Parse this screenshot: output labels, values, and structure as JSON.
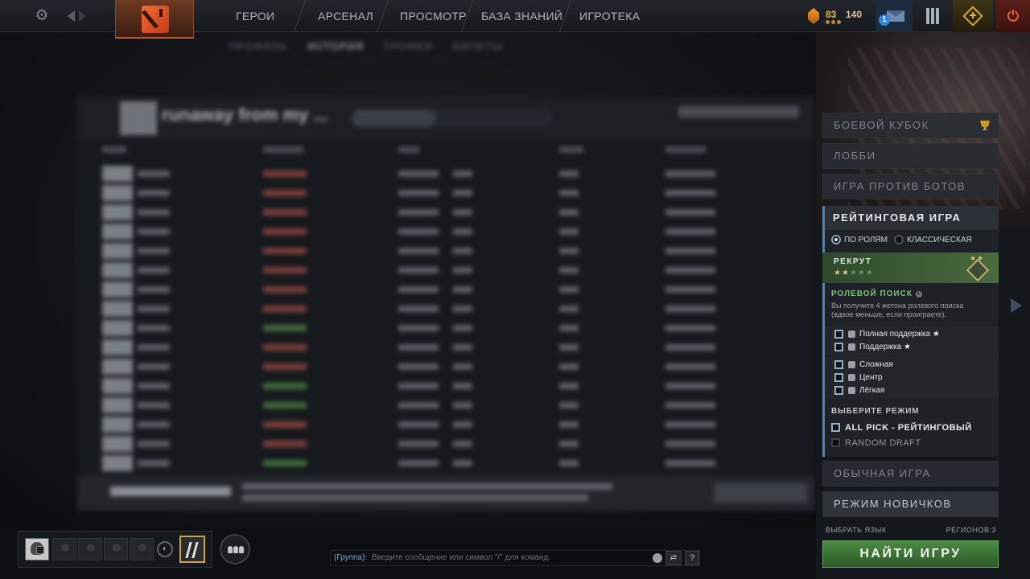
{
  "topbar": {
    "nav": [
      "ГЕРОИ",
      "АРСЕНАЛ",
      "ПРОСМОТР",
      "БАЗА ЗНАНИЙ",
      "ИГРОТЕКА"
    ],
    "gold": "83",
    "shards": "140",
    "mail_badge": "1",
    "icons": {
      "settings": "gear-icon",
      "back": "arrow-left-icon",
      "forward": "arrow-right-icon",
      "logo": "dota-logo",
      "currency": "gold-coin-icon",
      "mail": "mail-icon",
      "armory": "armory-icon",
      "plus": "dota-plus-icon",
      "power": "power-icon"
    }
  },
  "profile": {
    "subnav": [
      "ПРОФИЛЬ",
      "ИСТОРИЯ",
      "ТРОФЕИ",
      "БИЛЕТЫ"
    ],
    "name": "runaway from my ..."
  },
  "sidebar": {
    "menu": {
      "battle_cup": "БОЕВОЙ КУБОК",
      "lobby": "ЛОББИ",
      "bots": "ИГРА ПРОТИВ БОТОВ",
      "normal": "ОБЫЧНАЯ ИГРА",
      "novice": "РЕЖИМ НОВИЧКОВ"
    },
    "ranked": {
      "title": "РЕЙТИНГОВАЯ ИГРА",
      "queue_role": "ПО РОЛЯМ",
      "queue_classic": "КЛАССИЧЕСКАЯ",
      "rank_name": "РЕКРУТ",
      "rank_stars_lit": "★★",
      "rank_stars_unlit": "★★★",
      "medal_stars": "★★",
      "rank_stars": 2,
      "role_search_title": "РОЛЕВОЙ ПОИСК",
      "info_icon": "i",
      "role_search_desc": "Вы получите 4 жетона ролевого поиска (вдвое меньше, если проиграете).",
      "roles_support": [
        "Полная поддержка ★",
        "Поддержка ★"
      ],
      "roles_core": [
        "Сложная",
        "Центр",
        "Лёгкая"
      ],
      "mode_title": "ВЫБЕРИТЕ РЕЖИМ",
      "modes": [
        "ALL PICK - РЕЙТИНГОВЫЙ",
        "RANDOM DRAFT"
      ]
    },
    "language_label": "ВЫБРАТЬ ЯЗЫК",
    "regions_label": "РЕГИОНОВ:3",
    "find_button": "НАЙТИ ИГРУ"
  },
  "chat": {
    "channel": "(Группа):",
    "placeholder": "Введите сообщение или символ \"/\" для команд.",
    "help": "?"
  },
  "party": {
    "voice_icon": "headset-icon",
    "social_icon": "friends-icon"
  }
}
